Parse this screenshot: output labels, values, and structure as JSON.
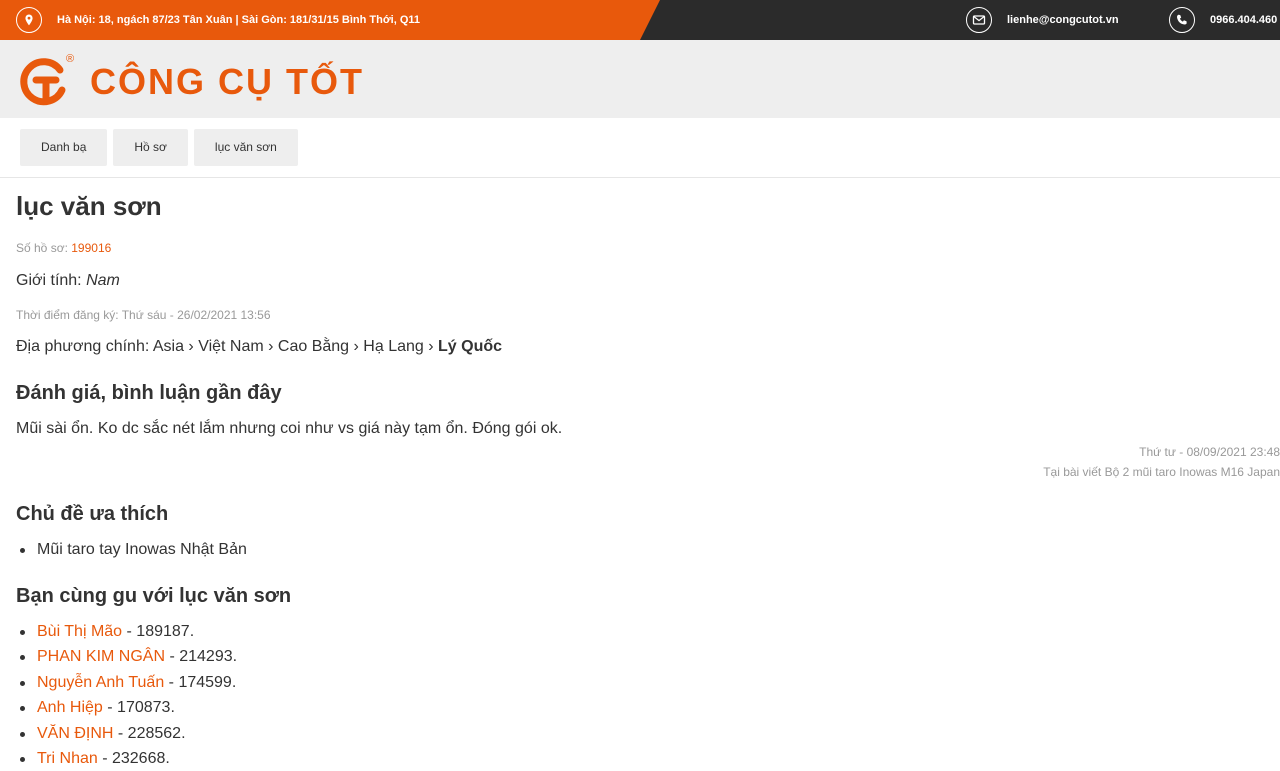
{
  "topbar": {
    "address": "Hà Nội: 18, ngách 87/23 Tân Xuân | Sài Gòn: 181/31/15 Bình Thới, Q11",
    "email": "lienhe@congcutot.vn",
    "phone": "0966.404.460",
    "icons": [
      "location-icon",
      "mail-icon",
      "phone-icon"
    ]
  },
  "header": {
    "brand": "CÔNG CỤ TỐT",
    "registered": "®"
  },
  "breadcrumb": [
    "Danh bạ",
    "Hồ sơ",
    "lục văn sơn"
  ],
  "profile": {
    "name": "lục văn sơn",
    "id_label": "Số hồ sơ:",
    "id_value": "199016",
    "gender_label": "Giới tính:",
    "gender_value": "Nam",
    "registered_label": "Thời điểm đăng ký:",
    "registered_value": "Thứ sáu - 26/02/2021 13:56",
    "location_label": "Địa phương chính:",
    "location_path": "Asia › Việt Nam › Cao Bằng › Hạ Lang ›",
    "location_last": "Lý Quốc"
  },
  "reviews": {
    "title": "Đánh giá, bình luận gần đây",
    "text": "Mũi sài ổn. Ko dc sắc nét lắm nhưng coi như vs giá này tạm ổn. Đóng gói ok.",
    "date": "Thứ tư - 08/09/2021 23:48",
    "post": "Tại bài viết Bộ 2 mũi taro Inowas M16 Japan"
  },
  "favorites": {
    "title": "Chủ đề ưa thích",
    "items": [
      "Mũi taro tay Inowas Nhật Bản"
    ]
  },
  "friends": {
    "title": "Bạn cùng gu với lục văn sơn",
    "items": [
      {
        "name": "Bùi Thị Mão",
        "id": " - 189187."
      },
      {
        "name": "PHAN KIM NGÂN",
        "id": " - 214293."
      },
      {
        "name": "Nguyễn Anh Tuấn",
        "id": " - 174599."
      },
      {
        "name": "Anh Hiệp",
        "id": " - 170873."
      },
      {
        "name": "VĂN ĐỊNH",
        "id": " - 228562."
      },
      {
        "name": "Tri Nhan",
        "id": " - 232668."
      }
    ]
  },
  "colors": {
    "accent": "#e8590c",
    "topbar_dark": "#2b2b2b",
    "header_bg": "#eeeeee"
  }
}
